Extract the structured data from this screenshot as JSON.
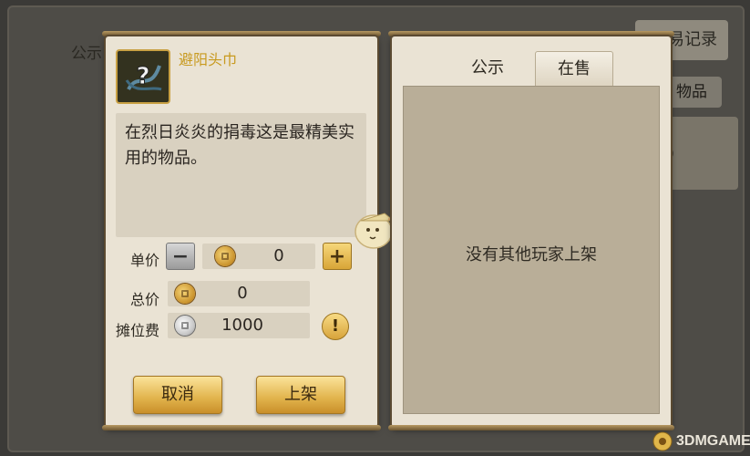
{
  "background": {
    "left_tab_label": "公示",
    "record_button_label": "易记录",
    "item_pill_label": "物品",
    "card_text": ")"
  },
  "item": {
    "icon": "question-mark-icon",
    "name": "避阳头巾",
    "description": "在烈日炎炎的捐毒这是最精美实用的物品。"
  },
  "pricing": {
    "unit_price_label": "单价",
    "unit_price_value": "0",
    "total_price_label": "总价",
    "total_price_value": "0",
    "stall_fee_label": "摊位费",
    "stall_fee_value": "1000",
    "minus_label": "−",
    "plus_label": "+",
    "info_label": "!"
  },
  "actions": {
    "cancel_label": "取消",
    "list_label": "上架"
  },
  "tabs": [
    {
      "label": "公示",
      "active": false
    },
    {
      "label": "在售",
      "active": true
    }
  ],
  "listing": {
    "empty_message": "没有其他玩家上架"
  },
  "watermark": {
    "text": "3DMGAME"
  },
  "colors": {
    "item_name": "#c89a1f",
    "gold_button": "#e1b34b",
    "panel_bg": "#eae3d4",
    "list_bg": "#b9ae98"
  }
}
